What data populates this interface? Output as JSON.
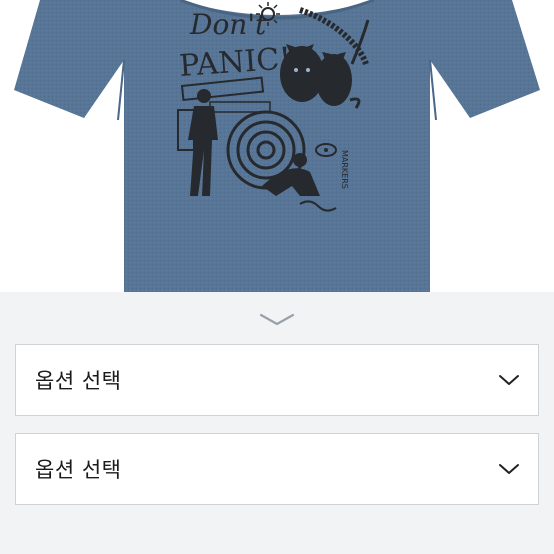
{
  "product": {
    "image_alt": "Blue t-shirt with Don't PANIC! graphic print",
    "print_lines": [
      "Don't",
      "PANIC!"
    ],
    "side_text": "MARKERS",
    "shirt_color": "#577596",
    "ink_color": "#26292e"
  },
  "sheet": {
    "handle_icon": "chevron-down-icon"
  },
  "options": [
    {
      "label": "옵션 선택",
      "icon": "chevron-down-icon"
    },
    {
      "label": "옵션 선택",
      "icon": "chevron-down-icon"
    }
  ],
  "colors": {
    "sheet_background": "#f2f3f5",
    "select_border": "#cfd2d6",
    "text": "#1b1b1b"
  }
}
